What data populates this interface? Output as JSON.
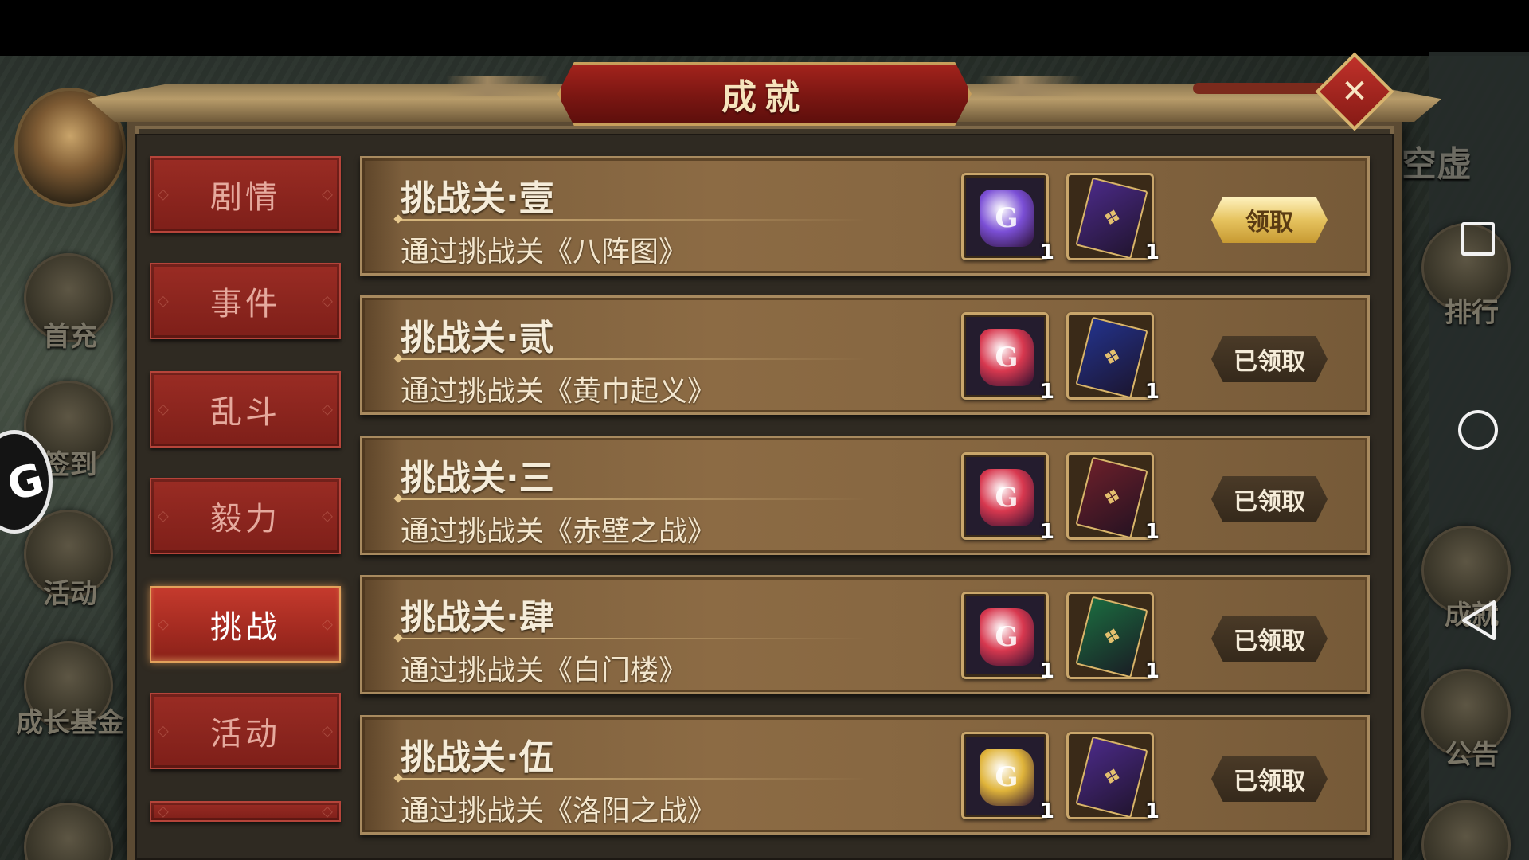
{
  "panel": {
    "title": "成就",
    "close_icon": "close-icon"
  },
  "categories": [
    {
      "label": "剧情",
      "active": false
    },
    {
      "label": "事件",
      "active": false
    },
    {
      "label": "乱斗",
      "active": false
    },
    {
      "label": "毅力",
      "active": false
    },
    {
      "label": "挑战",
      "active": true
    },
    {
      "label": "活动",
      "active": false
    }
  ],
  "achievements": [
    {
      "title": "挑战关·壹",
      "desc": "通过挑战关《八阵图》",
      "gem_color": "#7b4fd6",
      "book_color": "#4a2a86",
      "qty1": "1",
      "qty2": "1",
      "button": "领取",
      "claimed": false
    },
    {
      "title": "挑战关·贰",
      "desc": "通过挑战关《黄巾起义》",
      "gem_color": "#d8384f",
      "book_color": "#23328a",
      "qty1": "1",
      "qty2": "1",
      "button": "已领取",
      "claimed": true
    },
    {
      "title": "挑战关·三",
      "desc": "通过挑战关《赤壁之战》",
      "gem_color": "#d8384f",
      "book_color": "#6a1f2a",
      "qty1": "1",
      "qty2": "1",
      "button": "已领取",
      "claimed": true
    },
    {
      "title": "挑战关·肆",
      "desc": "通过挑战关《白门楼》",
      "gem_color": "#d8384f",
      "book_color": "#1b6a3f",
      "qty1": "1",
      "qty2": "1",
      "button": "已领取",
      "claimed": true
    },
    {
      "title": "挑战关·伍",
      "desc": "通过挑战关《洛阳之战》",
      "gem_color": "#e0b43a",
      "book_color": "#4a2a86",
      "qty1": "1",
      "qty2": "1",
      "button": "已领取",
      "claimed": true
    }
  ],
  "left_menu": [
    {
      "label": "首充",
      "icon": "first-charge-icon"
    },
    {
      "label": "签到",
      "icon": "sign-in-icon"
    },
    {
      "label": "活动",
      "icon": "event-icon"
    },
    {
      "label": "成长基金",
      "icon": "growth-fund-icon"
    }
  ],
  "right_menu": [
    {
      "label": "排行",
      "icon": "ranking-icon"
    },
    {
      "label": "成就",
      "icon": "achievement-icon"
    },
    {
      "label": "公告",
      "icon": "notice-icon"
    }
  ],
  "player_name": "空虚",
  "floating_widget_text": "G"
}
